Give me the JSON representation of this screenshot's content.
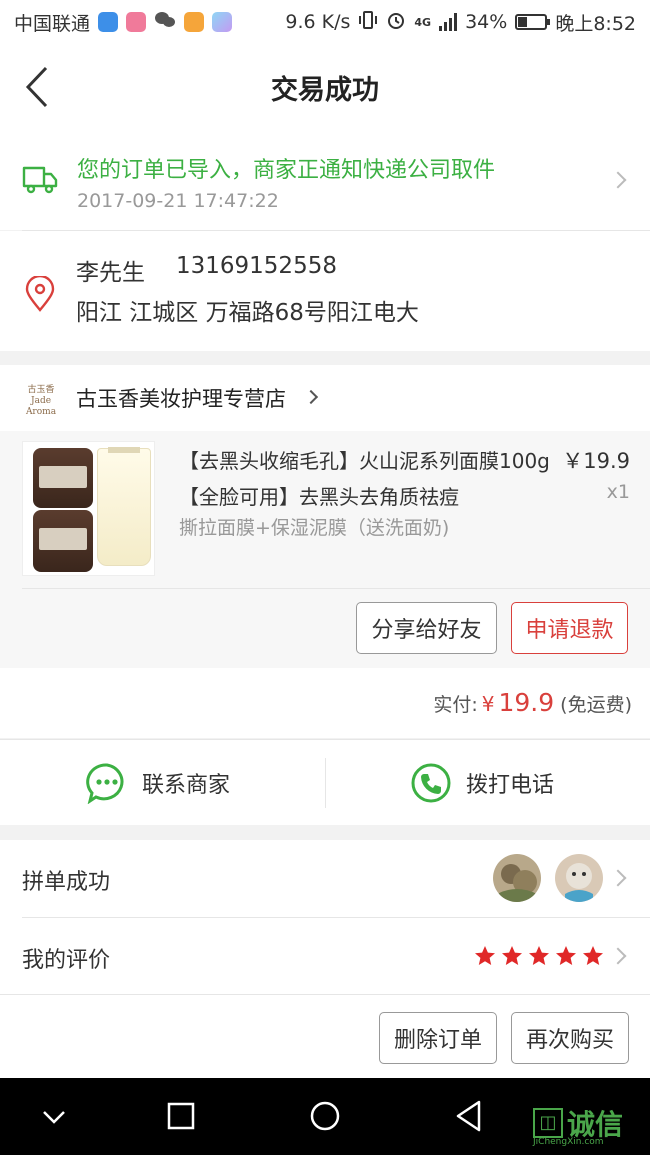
{
  "status_bar": {
    "carrier": "中国联通",
    "speed": "9.6 K/s",
    "network": "4G",
    "battery": "34%",
    "battery_level": 0.34,
    "time": "晚上8:52"
  },
  "header": {
    "title": "交易成功"
  },
  "logistics": {
    "message": "您的订单已导入，商家正通知快递公司取件",
    "time": "2017-09-21 17:47:22"
  },
  "address": {
    "name": "李先生",
    "phone": "13169152558",
    "full": "阳江 江城区 万福路68号阳江电大"
  },
  "store": {
    "logo_text": "古玉香 Jade Aroma",
    "name": "古玉香美妆护理专营店"
  },
  "product": {
    "title": "【去黑头收缩毛孔】火山泥系列面膜100g【全脸可用】去黑头去角质祛痘",
    "spec": "撕拉面膜+保湿泥膜（送洗面奶)",
    "price": "￥19.9",
    "quantity": "x1",
    "share_label": "分享给好友",
    "refund_label": "申请退款"
  },
  "payment": {
    "label": "实付:",
    "currency": "¥",
    "amount": "19.9",
    "note": "(免运费)"
  },
  "contact": {
    "merchant_label": "联系商家",
    "call_label": "拨打电话"
  },
  "group": {
    "label": "拼单成功"
  },
  "review": {
    "label": "我的评价",
    "rating": 5,
    "max_rating": 5
  },
  "actions": {
    "delete_label": "删除订单",
    "rebuy_label": "再次购买"
  },
  "watermark": {
    "text": "诚信",
    "sub": "JiChengXin.com"
  },
  "colors": {
    "green": "#3cb043",
    "red": "#d9403c",
    "star": "#e02828"
  }
}
